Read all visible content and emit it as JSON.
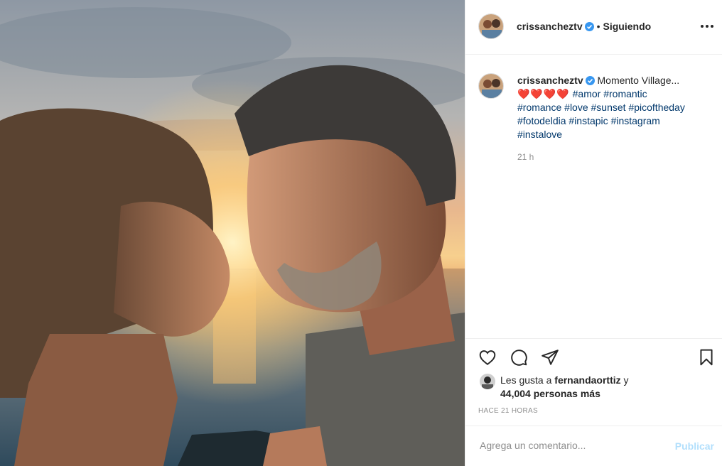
{
  "post": {
    "image_alt": "Couple face to face at sunset by the sea",
    "colors": {
      "verified": "#3897f0",
      "heart": "#ed4956",
      "hashtag": "#00376b",
      "publish_disabled": "#b2dffc"
    }
  },
  "header": {
    "username": "crissancheztv",
    "separator": "•",
    "follow_status": "Siguiendo",
    "more_icon": "more-horizontal-icon"
  },
  "caption": {
    "username": "crissancheztv",
    "text": "Momento Village...",
    "hearts": "❤️❤️❤️❤️",
    "hashtags": [
      "#amor",
      "#romantic",
      "#romance",
      "#love",
      "#sunset",
      "#picoftheday",
      "#fotodeldia",
      "#instapic",
      "#instagram",
      "#instalove"
    ],
    "time": "21 h"
  },
  "actions": {
    "like_icon": "heart-icon",
    "comment_icon": "comment-icon",
    "share_icon": "paper-plane-icon",
    "save_icon": "bookmark-icon"
  },
  "likes": {
    "prefix": "Les gusta a",
    "user": "fernandaorttiz",
    "conj": "y",
    "count": "44,004 personas más"
  },
  "timestamp": "HACE 21 HORAS",
  "comment": {
    "placeholder": "Agrega un comentario...",
    "publish_label": "Publicar"
  }
}
